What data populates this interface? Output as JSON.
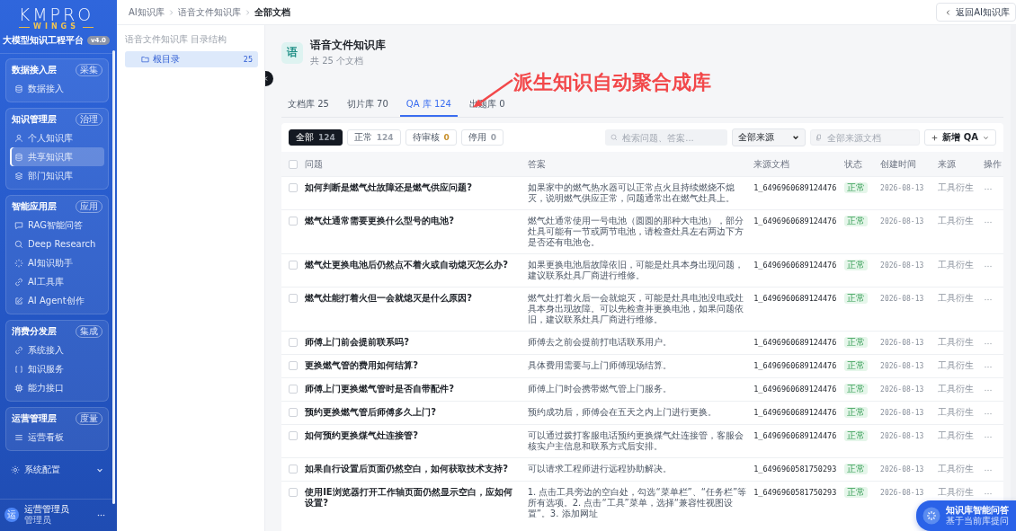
{
  "sidebar": {
    "logo": {
      "title": "KMPRO",
      "subtitle": "WINGS",
      "tagline": "大模型知识工程平台",
      "version": "v4.0"
    },
    "sections": [
      {
        "title": "数据接入层",
        "badge": "采集",
        "items": [
          {
            "label": "数据接入",
            "selected": false
          }
        ]
      },
      {
        "title": "知识管理层",
        "badge": "治理",
        "items": [
          {
            "label": "个人知识库",
            "selected": false
          },
          {
            "label": "共享知识库",
            "selected": true
          },
          {
            "label": "部门知识库",
            "selected": false
          }
        ]
      },
      {
        "title": "智能应用层",
        "badge": "应用",
        "items": [
          {
            "label": "RAG智能问答",
            "selected": false
          },
          {
            "label": "Deep Research",
            "selected": false
          },
          {
            "label": "AI知识助手",
            "selected": false
          },
          {
            "label": "AI工具库",
            "selected": false
          },
          {
            "label": "AI Agent创作",
            "selected": false
          }
        ]
      },
      {
        "title": "消费分发层",
        "badge": "集成",
        "items": [
          {
            "label": "系统接入",
            "selected": false
          },
          {
            "label": "知识服务",
            "selected": false
          },
          {
            "label": "能力接口",
            "selected": false
          }
        ]
      },
      {
        "title": "运营管理层",
        "badge": "度量",
        "items": [
          {
            "label": "运营看板",
            "selected": false
          }
        ]
      }
    ],
    "settings": {
      "label": "系统配置",
      "expanded": false
    },
    "user": {
      "avatar": "运",
      "name": "运营管理员",
      "role": "管理员"
    }
  },
  "breadcrumb": [
    "AI知识库",
    "语音文件知识库",
    "全部文档"
  ],
  "back_button": "返回AI知识库",
  "tree": {
    "heading": "语音文件知识库 目录结构",
    "items": [
      {
        "label": "根目录",
        "count": "25",
        "selected": true
      }
    ]
  },
  "library": {
    "icon": "语",
    "title": "语音文件知识库",
    "subtitle": "共 25 个文档"
  },
  "annotation": {
    "text": "派生知识自动聚合成库"
  },
  "tabs": [
    {
      "label": "文档库 25",
      "selected": false
    },
    {
      "label": "切片库 70",
      "selected": false
    },
    {
      "label": "QA 库 124",
      "selected": true
    },
    {
      "label": "出题库 0",
      "selected": false
    }
  ],
  "filters": [
    {
      "label": "全部",
      "count": "124",
      "selected": true,
      "color": "#9aa0aa"
    },
    {
      "label": "正常",
      "count": "124",
      "selected": false,
      "color": "#9aa0aa"
    },
    {
      "label": "待审核",
      "count": "0",
      "selected": false,
      "color": "#c8902c"
    },
    {
      "label": "停用",
      "count": "0",
      "selected": false,
      "color": "#9aa0aa"
    }
  ],
  "search": {
    "placeholder": "检索问题、答案..."
  },
  "source_select": {
    "value": "全部来源"
  },
  "doc_field": {
    "placeholder": "全部来源文档"
  },
  "add_button": "新增 QA",
  "table": {
    "all_checked": false,
    "columns": [
      "问题",
      "答案",
      "来源文档",
      "状态",
      "创建时间",
      "来源",
      "操作"
    ],
    "rows": [
      {
        "checked": false,
        "question": "如何判断是燃气灶故障还是燃气供应问题?",
        "answer": "如果家中的燃气热水器可以正常点火且持续燃烧不熄灭，说明燃气供应正常，问题通常出在燃气灶具上。",
        "doc": "1_6496960689124476",
        "status": "正常",
        "date": "2026-08-13",
        "source": "工具衍生"
      },
      {
        "checked": false,
        "question": "燃气灶通常需要更换什么型号的电池?",
        "answer": "燃气灶通常使用一号电池（圆圆的那种大电池），部分灶具可能有一节或两节电池，请检查灶具左右两边下方是否还有电池仓。",
        "doc": "1_6496960689124476",
        "status": "正常",
        "date": "2026-08-13",
        "source": "工具衍生"
      },
      {
        "checked": false,
        "question": "燃气灶更换电池后仍然点不着火或自动熄灭怎么办?",
        "answer": "如果更换电池后故障依旧，可能是灶具本身出现问题，建议联系灶具厂商进行维修。",
        "doc": "1_6496960689124476",
        "status": "正常",
        "date": "2026-08-13",
        "source": "工具衍生"
      },
      {
        "checked": false,
        "question": "燃气灶能打着火但一会就熄灭是什么原因?",
        "answer": "燃气灶打着火后一会就熄灭，可能是灶具电池没电或灶具本身出现故障。可以先检查并更换电池，如果问题依旧，建议联系灶具厂商进行维修。",
        "doc": "1_6496960689124476",
        "status": "正常",
        "date": "2026-08-13",
        "source": "工具衍生"
      },
      {
        "checked": false,
        "question": "师傅上门前会提前联系吗?",
        "answer": "师傅去之前会提前打电话联系用户。",
        "doc": "1_6496960689124476",
        "status": "正常",
        "date": "2026-08-13",
        "source": "工具衍生"
      },
      {
        "checked": false,
        "question": "更换燃气管的费用如何结算?",
        "answer": "具体费用需要与上门师傅现场结算。",
        "doc": "1_6496960689124476",
        "status": "正常",
        "date": "2026-08-13",
        "source": "工具衍生"
      },
      {
        "checked": false,
        "question": "师傅上门更换燃气管时是否自带配件?",
        "answer": "师傅上门时会携带燃气管上门服务。",
        "doc": "1_6496960689124476",
        "status": "正常",
        "date": "2026-08-13",
        "source": "工具衍生"
      },
      {
        "checked": false,
        "question": "预约更换燃气管后师傅多久上门?",
        "answer": "预约成功后，师傅会在五天之内上门进行更换。",
        "doc": "1_6496960689124476",
        "status": "正常",
        "date": "2026-08-13",
        "source": "工具衍生"
      },
      {
        "checked": false,
        "question": "如何预约更换煤气灶连接管?",
        "answer": "可以通过拨打客服电话预约更换煤气灶连接管，客服会核实户主信息和联系方式后安排。",
        "doc": "1_6496960689124476",
        "status": "正常",
        "date": "2026-08-13",
        "source": "工具衍生"
      },
      {
        "checked": false,
        "question": "如果自行设置后页面仍然空白，如何获取技术支持?",
        "answer": "可以请求工程师进行远程协助解决。",
        "doc": "1_6496960581750293",
        "status": "正常",
        "date": "2026-08-13",
        "source": "工具衍生"
      },
      {
        "checked": false,
        "question": "使用IE浏览器打开工作轴页面仍然显示空白，应如何设置?",
        "answer": "1. 点击工具旁边的空白处，勾选“菜单栏”、“任务栏”等所有选项。2. 点击“工具”菜单，选择“兼容性视图设置”。3. 添加网址",
        "doc": "1_6496960581750293",
        "status": "正常",
        "date": "2026-08-13",
        "source": "工具衍生"
      }
    ]
  },
  "assistant_button": {
    "title": "知识库智能问答",
    "subtitle": "基于当前库提问"
  }
}
